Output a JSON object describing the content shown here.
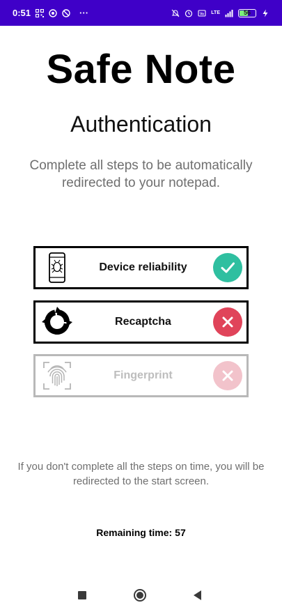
{
  "status_bar": {
    "time": "0:51",
    "more": "···",
    "network": "LTE",
    "battery": "56",
    "battery_level_percent": 56
  },
  "header": {
    "app_title": "Safe Note",
    "subtitle": "Authentication",
    "description": "Complete all steps to be automatically redirected to your notepad."
  },
  "steps": [
    {
      "label": "Device reliability",
      "icon": "phone-bug-icon",
      "status": "complete",
      "status_icon": "check-icon",
      "status_color": "#2fbfa0"
    },
    {
      "label": "Recaptcha",
      "icon": "recaptcha-icon",
      "status": "failed",
      "status_icon": "cross-icon",
      "status_color": "#e0445a"
    },
    {
      "label": "Fingerprint",
      "icon": "fingerprint-icon",
      "status": "pending",
      "status_icon": "cross-icon",
      "status_color": "#f2c3cb"
    }
  ],
  "footer": {
    "note": "If you don't complete all the steps on time, you will be redirected to the start screen.",
    "timer_label": "Remaining time:",
    "timer_value": "57"
  },
  "nav": {
    "buttons": [
      "recents-button",
      "home-button",
      "back-button"
    ]
  },
  "colors": {
    "status_bar": "#3f00c8",
    "card_border": "#000000",
    "card_border_disabled": "#b8b8b8",
    "text_muted": "#6f6f6f"
  }
}
